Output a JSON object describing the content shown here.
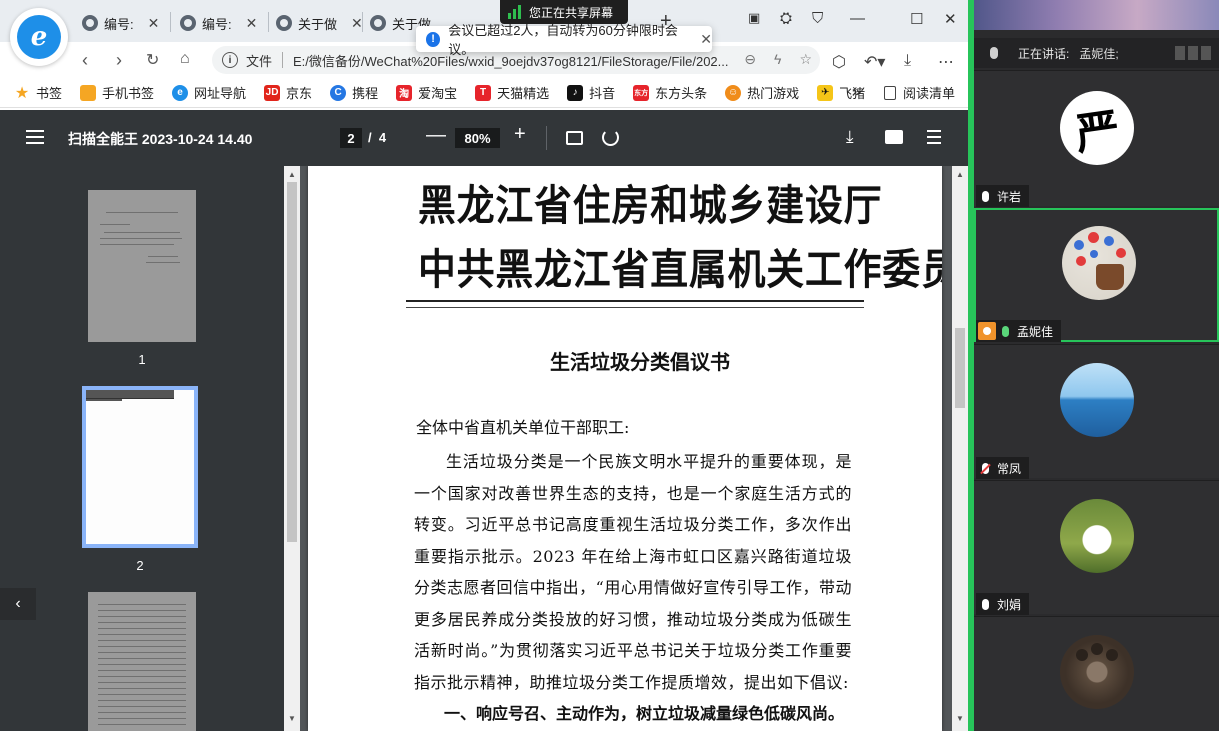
{
  "browser": {
    "tabs": [
      {
        "label": "编号:"
      },
      {
        "label": "编号:"
      },
      {
        "label": "关于做"
      },
      {
        "label": "关于做"
      }
    ],
    "share_banner": "您正在共享屏幕",
    "toast": "会议已超过2人，自动转为60分钟限时会议。",
    "address": {
      "scheme_label": "文件",
      "url": "E:/微信备份/WeChat%20Files/wxid_9oejdv37og8121/FileStorage/File/202..."
    },
    "bookmarks": [
      {
        "label": "书签",
        "icon": "star-icon",
        "color": "#f5a623"
      },
      {
        "label": "手机书签",
        "icon": "bookmark-folder-icon",
        "color": "#f5a623"
      },
      {
        "label": "网址导航",
        "icon": "e-browser-icon",
        "color": "#1e8fe8"
      },
      {
        "label": "京东",
        "icon": "jd-icon",
        "color": "#e1251b"
      },
      {
        "label": "携程",
        "icon": "ctrip-icon",
        "color": "#2577e3"
      },
      {
        "label": "爱淘宝",
        "icon": "taobao-icon",
        "color": "#e6242b"
      },
      {
        "label": "天猫精选",
        "icon": "tmall-icon",
        "color": "#e6242b"
      },
      {
        "label": "抖音",
        "icon": "douyin-icon",
        "color": "#111111"
      },
      {
        "label": "东方头条",
        "icon": "dongfang-icon",
        "color": "#e6242b"
      },
      {
        "label": "热门游戏",
        "icon": "game-icon",
        "color": "#f08c1a"
      },
      {
        "label": "飞猪",
        "icon": "fliggy-icon",
        "color": "#f5c518"
      }
    ],
    "reading_list": "阅读清单"
  },
  "pdf": {
    "title": "扫描全能王 2023-10-24 14.40",
    "current_page": "2",
    "page_sep": "/",
    "total_pages": "4",
    "zoom": "80%",
    "thumbnails": [
      {
        "label": "1"
      },
      {
        "label": "2"
      },
      {
        "label": ""
      }
    ],
    "document": {
      "header_line1": "黑龙江省住房和城乡建设厅",
      "header_line2": "中共黑龙江省直属机关工作委员会",
      "title": "生活垃圾分类倡议书",
      "salutation": "全体中省直机关单位干部职工:",
      "paragraph": "生活垃圾分类是一个民族文明水平提升的重要体现，是一个国家对改善世界生态的支持，也是一个家庭生活方式的转变。习近平总书记高度重视生活垃圾分类工作，多次作出重要指示批示。2023 年在给上海市虹口区嘉兴路街道垃圾分类志愿者回信中指出，“用心用情做好宣传引导工作，带动更多居民养成分类投放的好习惯，推动垃圾分类成为低碳生活新时尚。”为贯彻落实习近平总书记关于垃圾分类工作重要指示批示精神，助推垃圾分类工作提质增效，提出如下倡议:",
      "item1": "一、响应号召、主动作为，树立垃圾减量绿色低碳风尚。"
    }
  },
  "meeting": {
    "speaking_label": "正在讲话:",
    "speaking_name": "孟妮佳;",
    "participants": [
      {
        "name": "许岩",
        "mic": "on",
        "avatar": "calligraphy-avatar",
        "calligraphy": "严"
      },
      {
        "name": "孟妮佳",
        "mic": "on",
        "avatar": "painted-hand-avatar",
        "host": true,
        "active": true
      },
      {
        "name": "常凤",
        "mic": "off",
        "avatar": "sea-avatar"
      },
      {
        "name": "刘娟",
        "mic": "on",
        "avatar": "dog-avatar"
      },
      {
        "name": "",
        "mic": "on",
        "avatar": "paw-avatar"
      }
    ],
    "colors": {
      "active_border": "#27c45a",
      "host_badge": "#f0932b",
      "mic_off": "#e23b3b"
    }
  }
}
